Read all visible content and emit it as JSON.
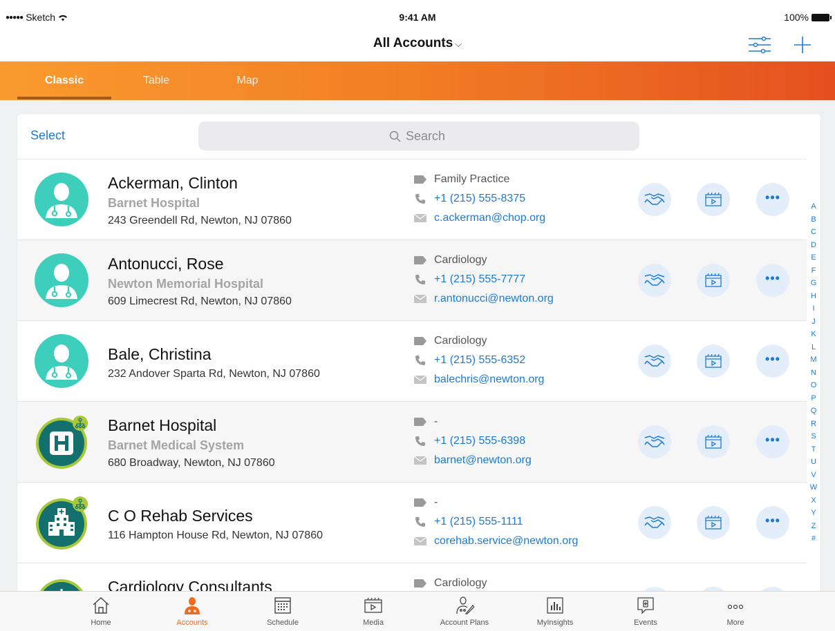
{
  "status_bar": {
    "carrier": "Sketch",
    "time": "9:41 AM",
    "battery": "100%"
  },
  "nav": {
    "title": "All Accounts"
  },
  "tabs": [
    {
      "label": "Classic",
      "active": true
    },
    {
      "label": "Table",
      "active": false
    },
    {
      "label": "Map",
      "active": false
    }
  ],
  "list": {
    "select_label": "Select",
    "search_placeholder": "Search",
    "rows": [
      {
        "type": "person",
        "name": "Ackerman, Clinton",
        "org": "Barnet Hospital",
        "address": "243 Greendell Rd, Newton, NJ 07860",
        "specialty": "Family Practice",
        "phone": "+1 (215) 555-8375",
        "email": "c.ackerman@chop.org"
      },
      {
        "type": "person",
        "name": "Antonucci, Rose",
        "org": "Newton Memorial Hospital",
        "address": "609 Limecrest Rd, Newton, NJ 07860",
        "specialty": "Cardiology",
        "phone": "+1 (215) 555-7777",
        "email": "r.antonucci@newton.org"
      },
      {
        "type": "person",
        "name": "Bale, Christina",
        "org": "",
        "address": "232 Andover Sparta Rd, Newton, NJ 07860",
        "specialty": "Cardiology",
        "phone": "+1 (215) 555-6352",
        "email": "balechris@newton.org"
      },
      {
        "type": "hospital",
        "name": "Barnet Hospital",
        "org": "Barnet Medical System",
        "address": "680 Broadway, Newton, NJ 07860",
        "specialty": "-",
        "phone": "+1 (215) 555-6398",
        "email": "barnet@newton.org"
      },
      {
        "type": "clinic",
        "name": "C O Rehab Services",
        "org": "",
        "address": "116 Hampton House Rd, Newton, NJ 07860",
        "specialty": "-",
        "phone": "+1 (215) 555-1111",
        "email": "corehab.service@newton.org"
      },
      {
        "type": "clinic",
        "name": "Cardiology Consultants",
        "org": "",
        "address": "",
        "specialty": "Cardiology",
        "phone": "",
        "email": ""
      }
    ]
  },
  "alphabet": [
    "A",
    "B",
    "C",
    "D",
    "E",
    "F",
    "G",
    "H",
    "I",
    "J",
    "K",
    "L",
    "M",
    "N",
    "O",
    "P",
    "Q",
    "R",
    "S",
    "T",
    "U",
    "V",
    "W",
    "X",
    "Y",
    "Z",
    "#"
  ],
  "tabbar": [
    {
      "label": "Home",
      "icon": "home-icon",
      "active": false
    },
    {
      "label": "Accounts",
      "icon": "accounts-icon",
      "active": true
    },
    {
      "label": "Schedule",
      "icon": "calendar-icon",
      "active": false
    },
    {
      "label": "Media",
      "icon": "media-icon",
      "active": false
    },
    {
      "label": "Account Plans",
      "icon": "account-plans-icon",
      "active": false
    },
    {
      "label": "MyInsights",
      "icon": "insights-icon",
      "active": false
    },
    {
      "label": "Events",
      "icon": "events-icon",
      "active": false
    },
    {
      "label": "More",
      "icon": "more-icon",
      "active": false
    }
  ],
  "colors": {
    "accent": "#1b7bd4",
    "brand_orange": "#f27d24",
    "teal": "#3dcfbc",
    "dark_teal": "#13706c",
    "badge_green": "#a7c83a"
  }
}
